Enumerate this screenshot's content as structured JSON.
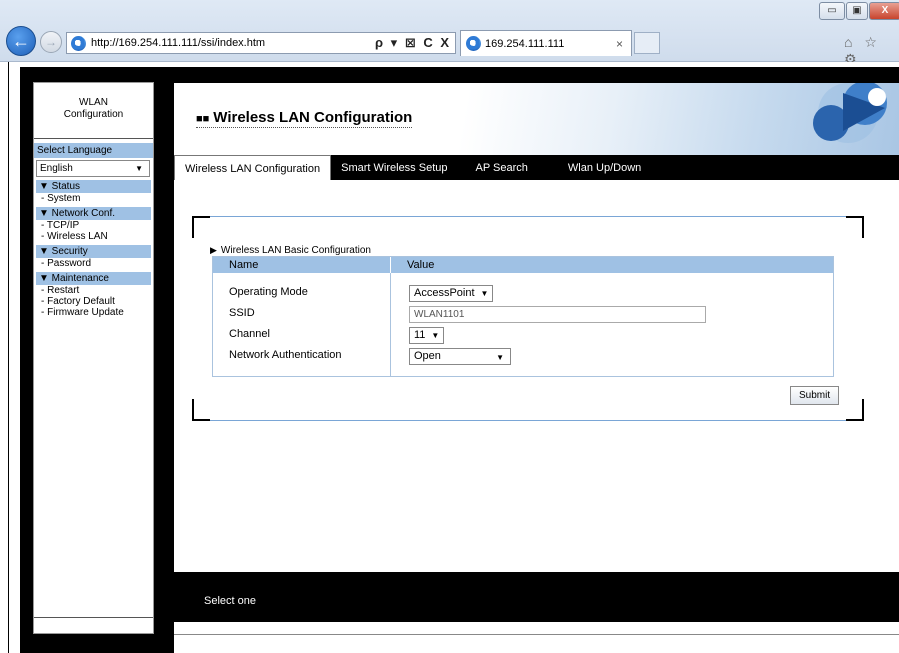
{
  "browser": {
    "window_controls": {
      "minimize": "▭",
      "maximize": "▣",
      "close": "X"
    },
    "address": "http://169.254.111.111/ssi/index.htm",
    "address_tools": "ρ ▾ ⊠ C X",
    "tab_title": "169.254.111.111",
    "tab_close": "×",
    "toolbar_icons": "⌂ ☆ ⚙"
  },
  "sidebar": {
    "title_line1": "WLAN",
    "title_line2": "Configuration",
    "language_label": "Select Language",
    "language_value": "English",
    "sections": [
      {
        "head": "▼ Status",
        "items": [
          "- System"
        ]
      },
      {
        "head": "▼ Network Conf.",
        "items": [
          "- TCP/IP",
          "- Wireless LAN"
        ]
      },
      {
        "head": "▼ Security",
        "items": [
          "- Password"
        ]
      },
      {
        "head": "▼ Maintenance",
        "items": [
          "- Restart",
          "- Factory Default",
          "- Firmware Update"
        ]
      }
    ]
  },
  "banner": {
    "title": "Wireless LAN Configuration"
  },
  "nav": [
    "Wireless LAN Configuration",
    "Smart Wireless Setup",
    "AP Search",
    "Wlan Up/Down"
  ],
  "config": {
    "section_title": "Wireless LAN Basic Configuration",
    "col_name": "Name",
    "col_value": "Value",
    "fields": [
      {
        "label": "Operating Mode",
        "value": "AccessPoint"
      },
      {
        "label": "SSID",
        "value": "WLAN1101"
      },
      {
        "label": "Channel",
        "value": "11"
      },
      {
        "label": "Network Authentication",
        "value": "Open"
      }
    ],
    "submit_label": "Submit"
  },
  "footer": {
    "status": "Select one"
  }
}
